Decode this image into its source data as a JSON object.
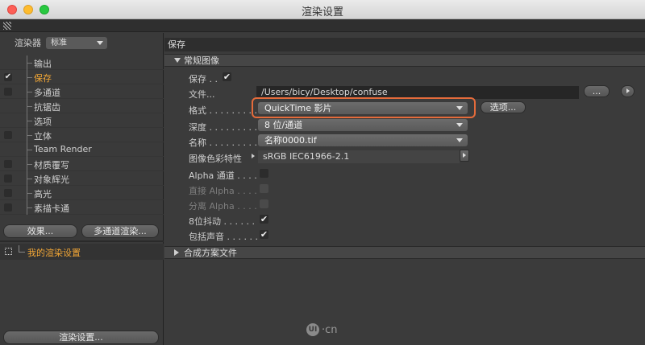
{
  "window": {
    "title": "渲染设置"
  },
  "left": {
    "renderer_label": "渲染器",
    "renderer_value": "标准",
    "items": [
      {
        "label": "输出",
        "checked": null,
        "selected": false
      },
      {
        "label": "保存",
        "checked": "✔",
        "selected": true
      },
      {
        "label": "多通道",
        "checked": "",
        "selected": false
      },
      {
        "label": "抗锯齿",
        "checked": null,
        "selected": false
      },
      {
        "label": "选项",
        "checked": null,
        "selected": false
      },
      {
        "label": "立体",
        "checked": "",
        "selected": false
      },
      {
        "label": "Team Render",
        "checked": null,
        "selected": false
      },
      {
        "label": "材质覆写",
        "checked": "",
        "selected": false
      },
      {
        "label": "对象辉光",
        "checked": "",
        "selected": false
      },
      {
        "label": "高光",
        "checked": "",
        "selected": false
      },
      {
        "label": "素描卡通",
        "checked": "",
        "selected": false
      }
    ],
    "effects_button": "效果...",
    "multipass_button": "多通道渲染...",
    "my_settings": "我的渲染设置",
    "render_settings_button": "渲染设置..."
  },
  "right": {
    "panel_title": "保存",
    "section_general": "常规图像",
    "save_label": "保存 . .",
    "save_checked": "✔",
    "file_label": "文件...",
    "file_path": "/Users/bicy/Desktop/confuse",
    "file_browse": "...",
    "format_label": "格式 . . . . . . . . .",
    "format_value": "QuickTime 影片",
    "options_button": "选项...",
    "depth_label": "深度 . . . . . . . . .",
    "depth_value": "8 位/通道",
    "name_label": "名称 . . . . . . . . .",
    "name_value": "名称0000.tif",
    "colorprofile_label": "图像色彩特性",
    "colorprofile_value": "sRGB IEC61966-2.1",
    "alpha_label": "Alpha 通道 . . . .",
    "straight_alpha_label": "直接 Alpha . . . .",
    "separate_alpha_label": "分离 Alpha . . . .",
    "dither_label": "8位抖动 . . . . . .",
    "dither_checked": "✔",
    "sound_label": "包括声音 . . . . . .",
    "sound_checked": "✔",
    "section_compositing": "合成方案文件"
  },
  "watermark": {
    "circle": "UI",
    "text": "·cn"
  },
  "colors": {
    "accent": "#f3a736",
    "highlight_border": "#e46b3b"
  }
}
